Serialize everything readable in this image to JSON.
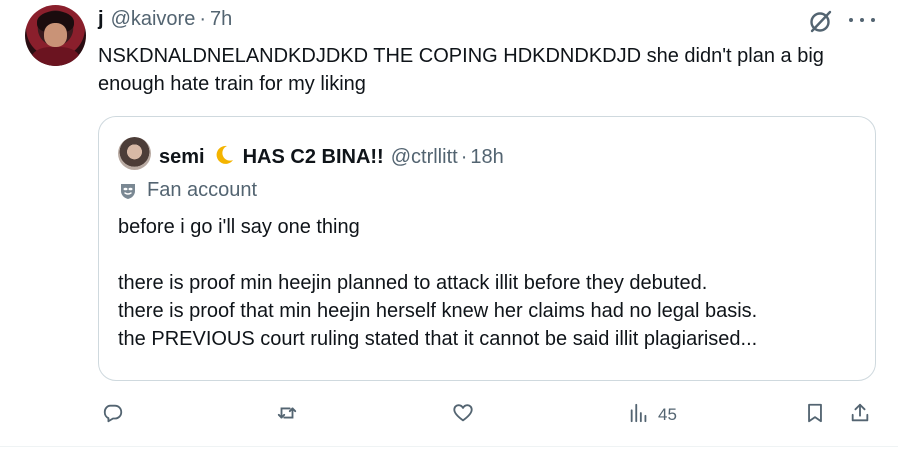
{
  "tweet": {
    "display_name": "j",
    "handle": "@kaivore",
    "separator": "·",
    "time": "7h",
    "text": "NSKDNALDNELANDKDJDKD THE COPING HDKDNDKDJD she didn't plan a big enough hate train for my liking"
  },
  "quote": {
    "display_name": "semi",
    "display_name_suffix": "HAS C2 BINA!!",
    "handle": "@ctrllitt",
    "separator": "·",
    "time": "18h",
    "label": "Fan account",
    "text": "before i go i'll say one thing\n\nthere is proof min heejin planned to attack illit before they debuted.\nthere is proof that min heejin herself knew her claims had no legal basis.\nthe PREVIOUS court ruling stated that it cannot be said illit plagiarised..."
  },
  "actions": {
    "views_count": "45"
  },
  "icons": {
    "top_right": [
      "grok-icon",
      "more-icon"
    ],
    "bar": [
      "reply-icon",
      "retweet-icon",
      "like-icon",
      "views-icon",
      "bookmark-icon",
      "share-icon"
    ]
  },
  "colors": {
    "text": "#0f1419",
    "secondary": "#536471",
    "border": "#cfd9de",
    "moon": "#f4b400"
  }
}
